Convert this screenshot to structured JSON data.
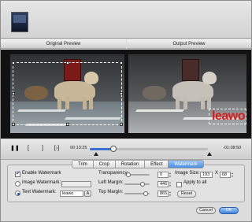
{
  "headers": {
    "original_preview": "Original Preview",
    "output_preview": "Output Preview"
  },
  "watermark_sample": "leawo",
  "playback": {
    "current_time": "00:13:25",
    "remaining_time": "-01:08:50",
    "progress": 0.2
  },
  "tabs": [
    {
      "label": "Trim",
      "active": false
    },
    {
      "label": "Crop",
      "active": false
    },
    {
      "label": "Rotation",
      "active": false
    },
    {
      "label": "Effect",
      "active": false
    },
    {
      "label": "Watermark",
      "active": true
    }
  ],
  "watermark": {
    "enable_label": "Enable Watermark",
    "enable_checked": true,
    "image_label": "Image Watermark:",
    "image_selected": false,
    "text_label": "Text Watermark:",
    "text_selected": true,
    "text_value": "leawo",
    "transparency_label": "Transparency:",
    "transparency_value": "0",
    "left_margin_label": "Left Margin:",
    "left_margin_value": "446",
    "top_margin_label": "Top Margin:",
    "top_margin_value": "865",
    "image_size_label": "Image Size:",
    "image_width": "193",
    "size_separator": "X",
    "image_height": "68",
    "apply_all_label": "Apply to all",
    "apply_all_checked": false,
    "reset_label": "Reset"
  },
  "footer": {
    "cancel_label": "Cancel",
    "ok_label": "OK"
  },
  "colors": {
    "accent": "#4b8fe0",
    "watermark_text": "#d81c1c"
  }
}
